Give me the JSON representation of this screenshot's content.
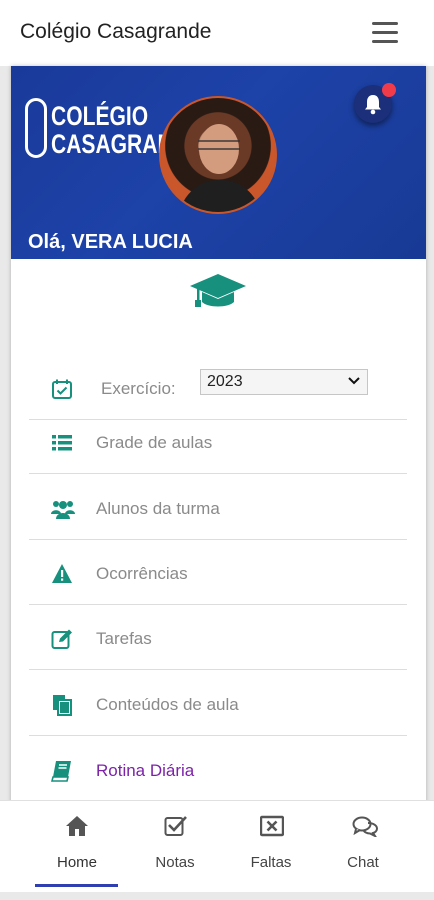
{
  "header": {
    "title": "Colégio Casagrande"
  },
  "banner": {
    "logo_line1": "COLÉGIO",
    "logo_line2": "CASAGRANDE",
    "greeting": "Olá, VERA LUCIA"
  },
  "exercise": {
    "label": "Exercício:",
    "value": "2023"
  },
  "menu": {
    "items": [
      {
        "label": "Grade de aulas",
        "icon": "list-icon"
      },
      {
        "label": "Alunos da turma",
        "icon": "users-icon"
      },
      {
        "label": "Ocorrências",
        "icon": "warning-icon"
      },
      {
        "label": "Tarefas",
        "icon": "edit-icon"
      },
      {
        "label": "Conteúdos de aula",
        "icon": "copy-icon"
      },
      {
        "label": "Rotina Diária",
        "icon": "book-icon"
      }
    ]
  },
  "nav": {
    "tabs": [
      {
        "label": "Home",
        "icon": "home-icon"
      },
      {
        "label": "Notas",
        "icon": "checkbox-icon"
      },
      {
        "label": "Faltas",
        "icon": "x-box-icon"
      },
      {
        "label": "Chat",
        "icon": "chat-icon"
      }
    ]
  },
  "colors": {
    "teal": "#17907e",
    "active": "#7c22a9",
    "banner": "#1d42a8",
    "nav_indicator": "#2f3fb0"
  }
}
